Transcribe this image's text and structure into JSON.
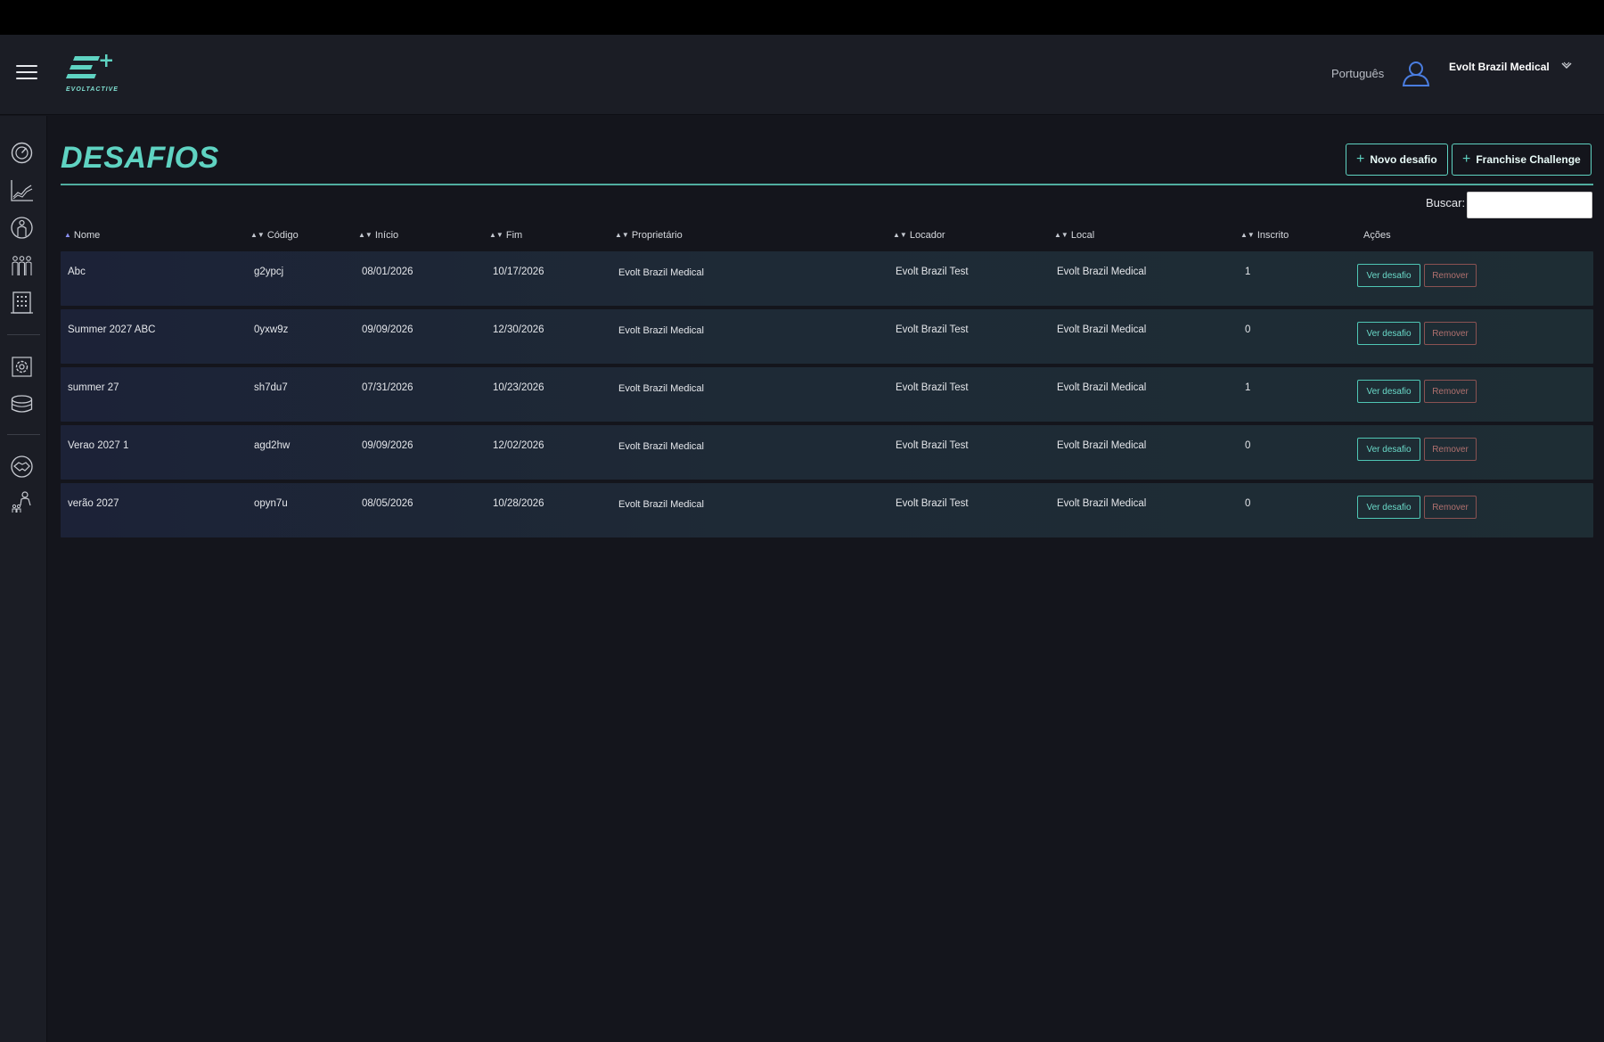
{
  "header": {
    "logo_text": "EVOLTACTIVE",
    "language": "Português",
    "user_name": "Evolt Brazil Medical"
  },
  "sidebar": {
    "icons": [
      "speedometer-icon",
      "line-chart-icon",
      "person-circle-icon",
      "group-icon",
      "building-icon",
      "settings-gear-icon",
      "database-icon",
      "handshake-icon",
      "organization-icon"
    ]
  },
  "page": {
    "title": "DESAFIOS",
    "new_challenge_label": "Novo desafio",
    "franchise_challenge_label": "Franchise Challenge",
    "search_label": "Buscar:",
    "search_value": ""
  },
  "table": {
    "columns": [
      "Nome",
      "Código",
      "Início",
      "Fim",
      "Proprietário",
      "Locador",
      "Local",
      "Inscrito",
      "Ações"
    ],
    "view_label": "Ver desafio",
    "remove_label": "Remover",
    "rows": [
      {
        "nome": "Abc",
        "codigo": "g2ypcj",
        "inicio": "08/01/2026",
        "fim": "10/17/2026",
        "proprietario": "Evolt Brazil Medical",
        "locador": "Evolt Brazil Test",
        "local": "Evolt Brazil Medical",
        "inscrito": "1"
      },
      {
        "nome": "Summer 2027 ABC",
        "codigo": "0yxw9z",
        "inicio": "09/09/2026",
        "fim": "12/30/2026",
        "proprietario": "Evolt Brazil Medical",
        "locador": "Evolt Brazil Test",
        "local": "Evolt Brazil Medical",
        "inscrito": "0"
      },
      {
        "nome": "summer 27",
        "codigo": "sh7du7",
        "inicio": "07/31/2026",
        "fim": "10/23/2026",
        "proprietario": "Evolt Brazil Medical",
        "locador": "Evolt Brazil Test",
        "local": "Evolt Brazil Medical",
        "inscrito": "1"
      },
      {
        "nome": "Verao 2027 1",
        "codigo": "agd2hw",
        "inicio": "09/09/2026",
        "fim": "12/02/2026",
        "proprietario": "Evolt Brazil Medical",
        "locador": "Evolt Brazil Test",
        "local": "Evolt Brazil Medical",
        "inscrito": "0"
      },
      {
        "nome": "verão 2027",
        "codigo": "opyn7u",
        "inicio": "08/05/2026",
        "fim": "10/28/2026",
        "proprietario": "Evolt Brazil Medical",
        "locador": "Evolt Brazil Test",
        "local": "Evolt Brazil Medical",
        "inscrito": "0"
      }
    ]
  },
  "colors": {
    "accent": "#5fd3c2",
    "remove": "#b0706e",
    "background": "#14151c",
    "panel": "#1b1d25"
  }
}
